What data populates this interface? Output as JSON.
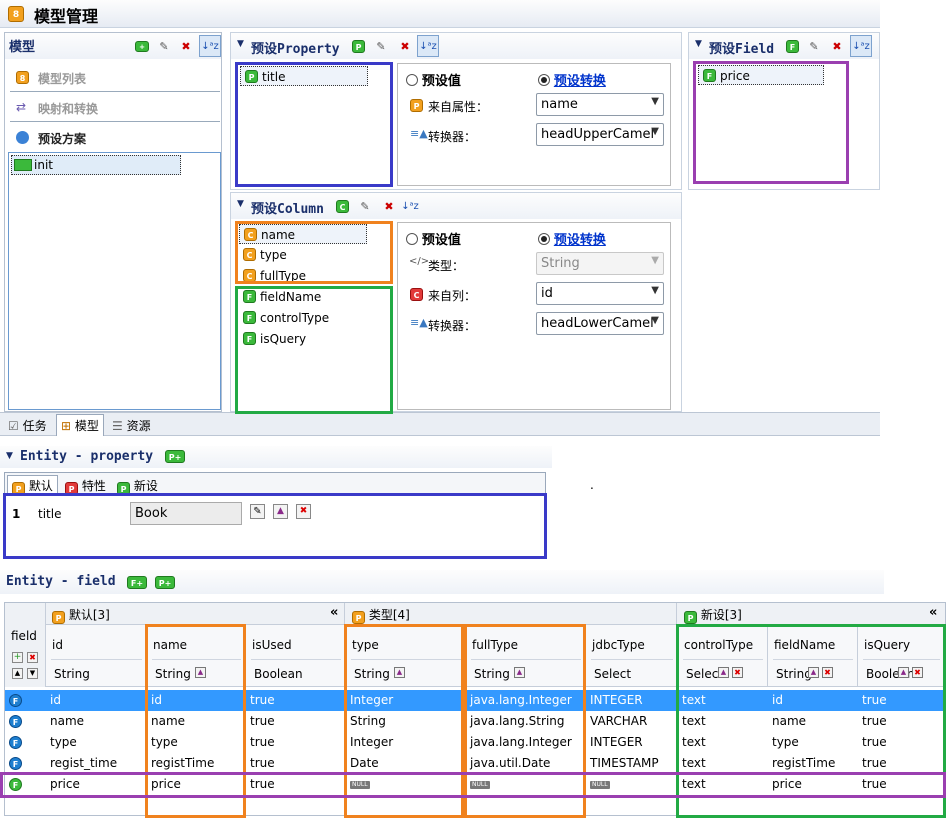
{
  "window": {
    "title": "模型管理"
  },
  "left_panel": {
    "header": "模型",
    "nav": [
      "模型列表",
      "映射和转换",
      "预设方案"
    ],
    "tree_item": "init"
  },
  "bottom_tabs": [
    "任务",
    "模型",
    "资源"
  ],
  "preset_property": {
    "header": "预设Property",
    "items": [
      "title"
    ],
    "radio_preset": "预设值",
    "radio_convert": "预设转换",
    "label_from_attr": "来自属性：",
    "label_converter": "转换器：",
    "from_attr_value": "name",
    "converter_value": "headUpperCamel"
  },
  "preset_field": {
    "header": "预设Field",
    "items": [
      "price"
    ]
  },
  "preset_column": {
    "header": "预设Column",
    "items_orange": [
      "name",
      "type",
      "fullType"
    ],
    "items_green": [
      "fieldName",
      "controlType",
      "isQuery"
    ],
    "radio_preset": "预设值",
    "radio_convert": "预设转换",
    "label_type": "类型：",
    "label_from_col": "来自列：",
    "label_converter": "转换器：",
    "type_value": "String",
    "from_col_value": "id",
    "converter_value": "headLowerCamel"
  },
  "entity_property": {
    "header": "Entity - property",
    "tabs": [
      "默认",
      "特性",
      "新设"
    ],
    "row": {
      "num": "1",
      "name": "title",
      "value": "Book"
    },
    "dot": "."
  },
  "entity_field": {
    "header": "Entity - field",
    "field_label": "field",
    "groups": [
      "默认[3]",
      "类型[4]",
      "新设[3]"
    ],
    "collapse": "«",
    "columns": [
      {
        "name": "id",
        "type": "String"
      },
      {
        "name": "name",
        "type": "String"
      },
      {
        "name": "isUsed",
        "type": "Boolean"
      },
      {
        "name": "type",
        "type": "String"
      },
      {
        "name": "fullType",
        "type": "String"
      },
      {
        "name": "jdbcType",
        "type": "Select"
      },
      {
        "name": "controlType",
        "type": "Select"
      },
      {
        "name": "fieldName",
        "type": "String"
      },
      {
        "name": "isQuery",
        "type": "Boolean"
      }
    ],
    "null_label": "NULL",
    "rows": [
      [
        "id",
        "id",
        "true",
        "Integer",
        "java.lang.Integer",
        "INTEGER",
        "text",
        "id",
        "true"
      ],
      [
        "name",
        "name",
        "true",
        "String",
        "java.lang.String",
        "VARCHAR",
        "text",
        "name",
        "true"
      ],
      [
        "type",
        "type",
        "true",
        "Integer",
        "java.lang.Integer",
        "INTEGER",
        "text",
        "type",
        "true"
      ],
      [
        "regist_time",
        "registTime",
        "true",
        "Date",
        "java.util.Date",
        "TIMESTAMP",
        "text",
        "registTime",
        "true"
      ],
      [
        "price",
        "price",
        "true",
        "",
        "",
        "",
        "text",
        "price",
        "true"
      ]
    ]
  },
  "colors": {
    "blue_frame": "#3a3ac8",
    "orange_frame": "#f0821e",
    "green_frame": "#22aa44",
    "purple_frame": "#9a3fb0",
    "selection": "#3399ff"
  }
}
